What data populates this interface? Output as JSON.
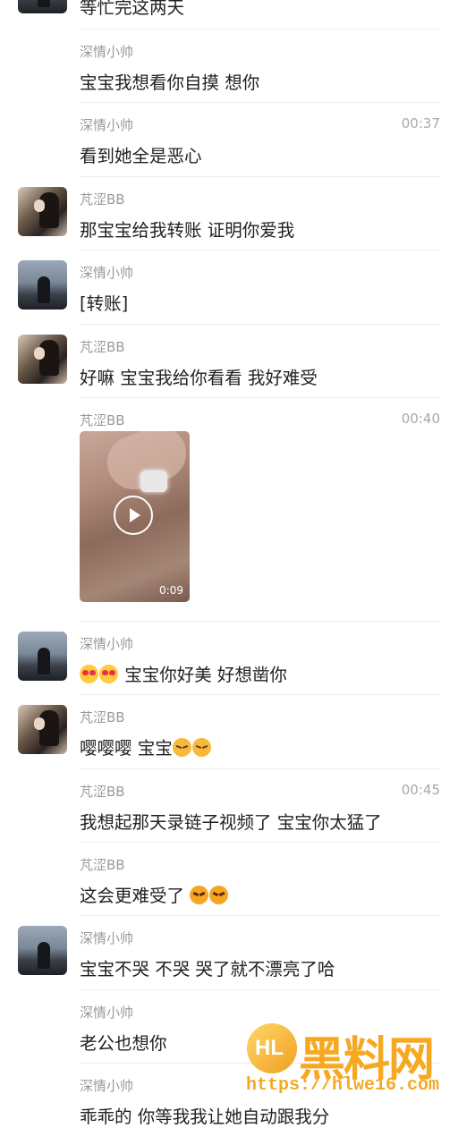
{
  "messages": [
    {
      "id": "m0",
      "sender": "",
      "text": "等忙完这两天",
      "time": ""
    },
    {
      "id": "m1",
      "sender": "深情小帅",
      "text": "宝宝我想看你自摸 想你",
      "time": ""
    },
    {
      "id": "m2",
      "sender": "深情小帅",
      "text": "看到她全是恶心",
      "time": "00:37"
    },
    {
      "id": "m3",
      "sender": "芃涩BB",
      "text": "那宝宝给我转账 证明你爱我",
      "time": ""
    },
    {
      "id": "m4",
      "sender": "深情小帅",
      "text": "[转账]",
      "time": ""
    },
    {
      "id": "m5",
      "sender": "芃涩BB",
      "text": "好嘛 宝宝我给你看看 我好难受",
      "time": ""
    },
    {
      "id": "m6",
      "sender": "芃涩BB",
      "text": "",
      "time": "00:40",
      "video_duration": "0:09"
    },
    {
      "id": "m7",
      "sender": "深情小帅",
      "text": "宝宝你好美 好想凿你",
      "time": ""
    },
    {
      "id": "m8",
      "sender": "芃涩BB",
      "text": "嘤嘤嘤 宝宝",
      "time": ""
    },
    {
      "id": "m9",
      "sender": "芃涩BB",
      "text": "我想起那天录链子视频了 宝宝你太猛了",
      "time": "00:45"
    },
    {
      "id": "m10",
      "sender": "芃涩BB",
      "text": "这会更难受了",
      "time": ""
    },
    {
      "id": "m11",
      "sender": "深情小帅",
      "text": "宝宝不哭 不哭 哭了就不漂亮了哈",
      "time": ""
    },
    {
      "id": "m12",
      "sender": "深情小帅",
      "text": "老公也想你",
      "time": ""
    },
    {
      "id": "m13",
      "sender": "深情小帅",
      "text": "乖乖的 你等我我让她自动跟我分",
      "time": ""
    }
  ],
  "watermark": {
    "title": "黑料网",
    "url": "https://hlwe16.com",
    "color": "#f6a821"
  },
  "icons": {
    "play": "play-icon",
    "avatar_girl": "avatar-girl",
    "avatar_guy": "avatar-guy"
  }
}
